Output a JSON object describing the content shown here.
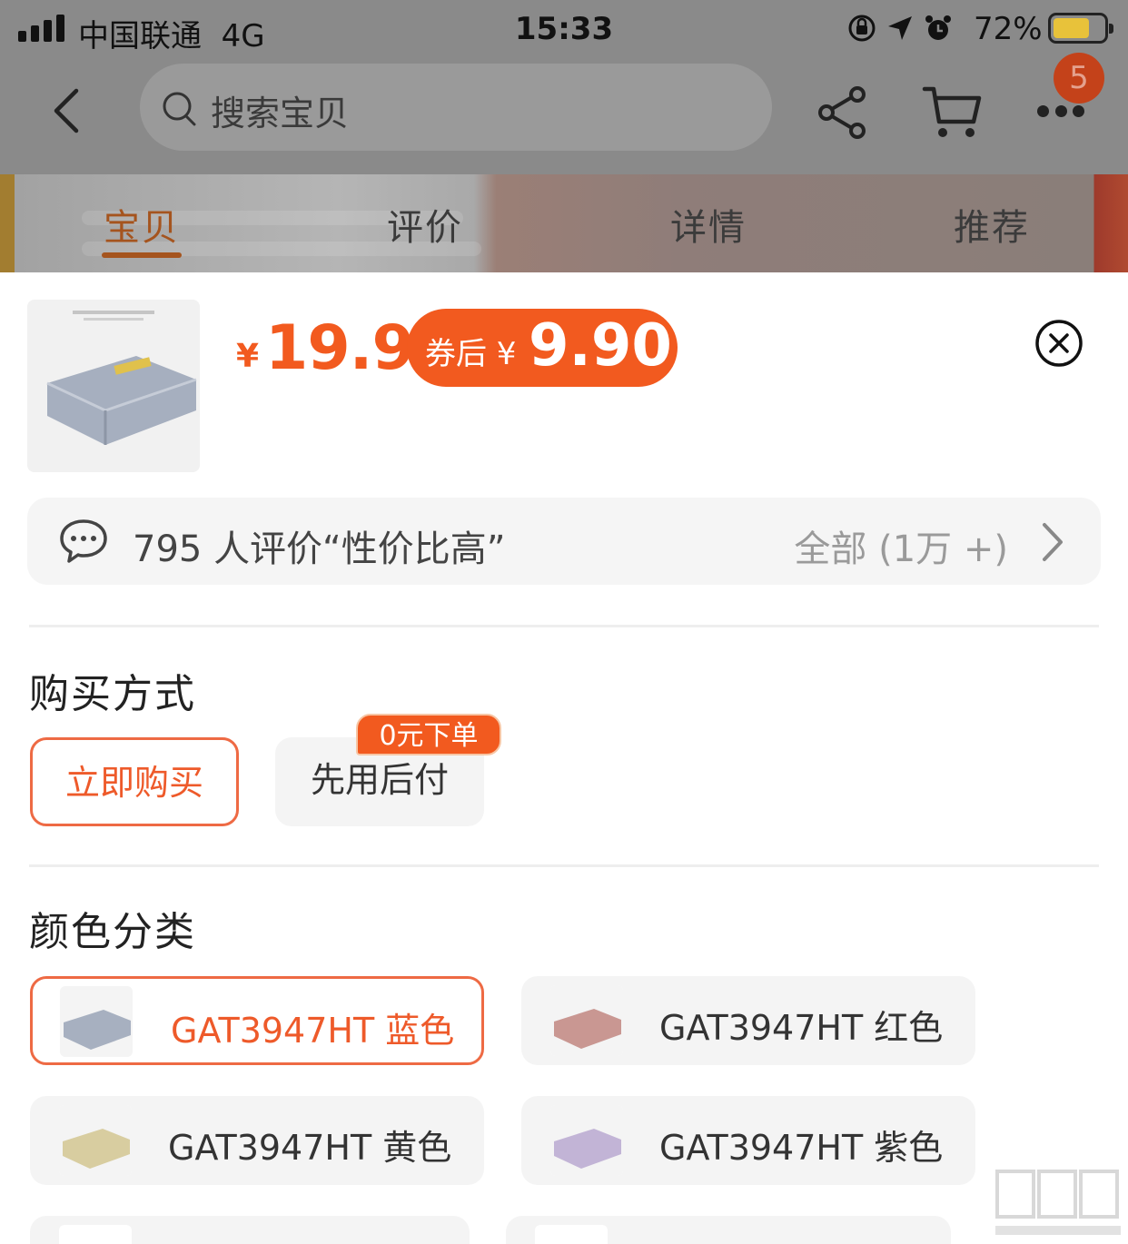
{
  "status_bar": {
    "carrier": "中国联通",
    "network": "4G",
    "time": "15:33",
    "battery": "72%",
    "battery_level": 0.72
  },
  "navbar": {
    "search_placeholder": "搜索宝贝",
    "more_badge": "5",
    "icons": [
      "back-icon",
      "search-icon",
      "share-icon",
      "cart-icon",
      "more-icon"
    ]
  },
  "tabs": [
    {
      "label": "宝贝",
      "active": true
    },
    {
      "label": "评价",
      "active": false
    },
    {
      "label": "详情",
      "active": false
    },
    {
      "label": "推荐",
      "active": false
    }
  ],
  "product": {
    "currency": "¥",
    "price": "19.9",
    "coupon_label": "券后 ¥",
    "coupon_price": "9.90"
  },
  "review": {
    "text": "795 人评价“性价比高”",
    "all_label": "全部 (1万 +)"
  },
  "purchase": {
    "title": "购买方式",
    "options": [
      {
        "label": "立即购买",
        "selected": true
      },
      {
        "label": "先用后付",
        "selected": false,
        "tag": "0元下单"
      }
    ]
  },
  "colors": {
    "title": "颜色分类",
    "options": [
      {
        "label": "GAT3947HT 蓝色",
        "selected": true
      },
      {
        "label": "GAT3947HT 红色",
        "selected": false
      },
      {
        "label": "GAT3947HT 黄色",
        "selected": false
      },
      {
        "label": "GAT3947HT 紫色",
        "selected": false
      }
    ]
  },
  "theme": {
    "accent": "#f25a1f",
    "selected_border": "#ee6a44",
    "option_bg": "#f4f4f4"
  }
}
